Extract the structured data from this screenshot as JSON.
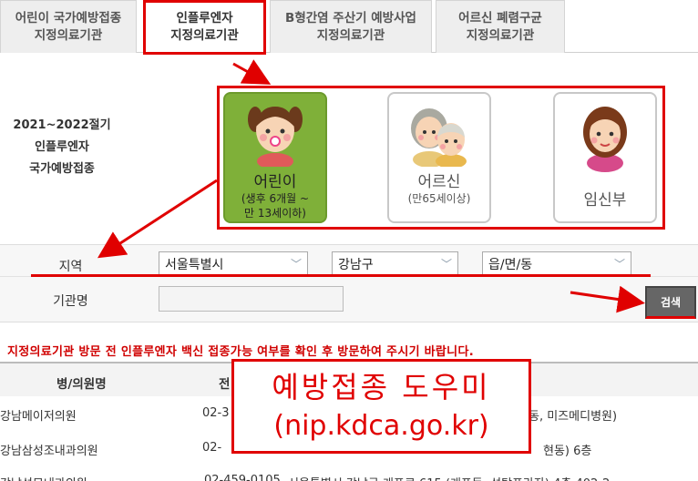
{
  "tabs": [
    {
      "line1": "어린이 국가예방접종",
      "line2": "지정의료기관"
    },
    {
      "line1": "인플루엔자",
      "line2": "지정의료기관"
    },
    {
      "line1": "B형간염 주산기 예방사업",
      "line2": "지정의료기관"
    },
    {
      "line1": "어르신 폐렴구균",
      "line2": "지정의료기관"
    }
  ],
  "active_tab": 1,
  "season": {
    "line1": "2021~2022절기",
    "line2": "인플루엔자",
    "line3": "국가예방접종"
  },
  "categories": [
    {
      "name": "어린이",
      "sub1": "(생후 6개월 ~",
      "sub2": "만 13세이하)",
      "selected": true,
      "icon": "child-face-icon"
    },
    {
      "name": "어르신",
      "sub1": "(만65세이상)",
      "sub2": "",
      "selected": false,
      "icon": "senior-couple-icon"
    },
    {
      "name": "임신부",
      "sub1": "",
      "sub2": "",
      "selected": false,
      "icon": "pregnant-woman-icon"
    }
  ],
  "filters": {
    "region_label": "지역",
    "institution_label": "기관명",
    "city": "서울특별시",
    "district": "강남구",
    "dong": "읍/면/동",
    "search_button": "검색"
  },
  "notice": "지정의료기관 방문 전 인플루엔자 백신 접종가능 여부를 확인 후 방문하여 주시기 바랍니다.",
  "table": {
    "headers": {
      "name": "병/의원명",
      "tel": "전"
    },
    "rows": [
      {
        "name": "강남메이저의원",
        "tel": "02-3",
        "addr": "동, 미즈메디병원)"
      },
      {
        "name": "강남삼성조내과의원",
        "tel": "02-",
        "addr": "현동) 6층"
      },
      {
        "name": "강남성모내과의원",
        "tel": "02-459-0105",
        "addr": "서울특별시 강남구 개포로 615 (개포동, 성탁프라자) 4층 402-2"
      }
    ]
  },
  "overlay": {
    "title": "예방접종 도우미",
    "url": "(nip.kdca.go.kr)"
  },
  "colors": {
    "accent_red": "#e00000",
    "selected_green": "#7fb039"
  }
}
